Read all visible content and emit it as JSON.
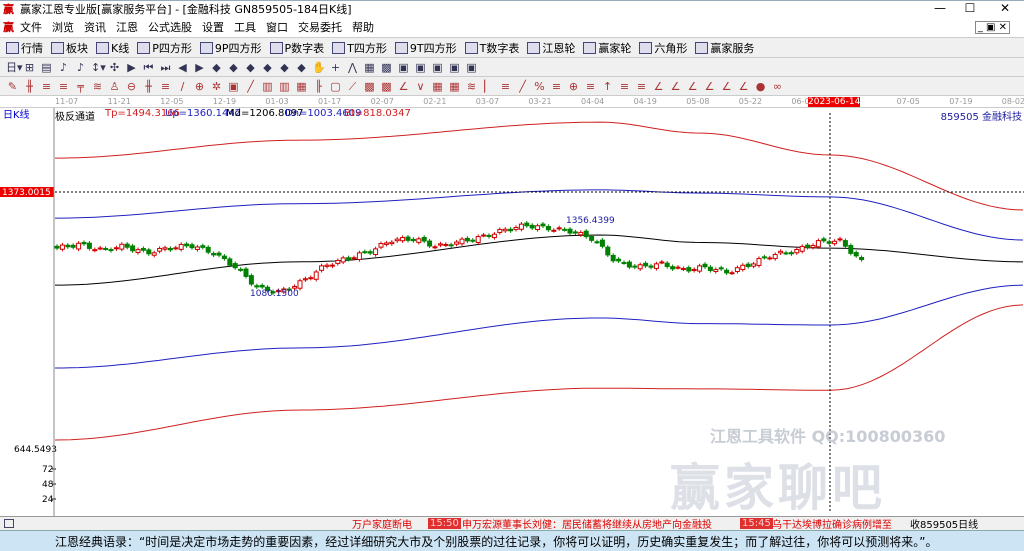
{
  "window": {
    "title": "赢家江恩专业版[赢家服务平台] - [金融科技  GN859505-184日K线]",
    "logo": "赢",
    "min": "—",
    "max": "☐",
    "close": "✕"
  },
  "menu": [
    "文件",
    "浏览",
    "资讯",
    "江恩",
    "公式选股",
    "设置",
    "工具",
    "窗口",
    "交易委托",
    "帮助"
  ],
  "toolbar": [
    {
      "icon": "grid-icon",
      "label": "行情"
    },
    {
      "icon": "blocks-icon",
      "label": "板块"
    },
    {
      "icon": "candle-icon",
      "label": "K线"
    },
    {
      "icon": "p-square-icon",
      "label": "P四方形"
    },
    {
      "icon": "9p-icon",
      "label": "9P四方形"
    },
    {
      "icon": "pn-icon",
      "label": "P数字表"
    },
    {
      "icon": "t-square-icon",
      "label": "T四方形"
    },
    {
      "icon": "9t-icon",
      "label": "9T四方形"
    },
    {
      "icon": "tn-icon",
      "label": "T数字表"
    },
    {
      "icon": "wheel-icon",
      "label": "江恩轮"
    },
    {
      "icon": "winner-wheel-icon",
      "label": "赢家轮"
    },
    {
      "icon": "hexagon-icon",
      "label": "六角形"
    },
    {
      "icon": "dollar-icon",
      "label": "赢家服务"
    }
  ],
  "period_label": "日K线",
  "indicator": {
    "name": "极反通道",
    "tp": "Tp=1494.3166",
    "up": "Up=1360.1442",
    "md": "Md=1206.8097",
    "dn": "Dn=1003.4609",
    "bt": "Bt=818.0347"
  },
  "stock_label": "859505  金融科技",
  "dates": [
    "11-07",
    "11-21",
    "12-05",
    "12-19",
    "01-03",
    "01-17",
    "02-07",
    "02-21",
    "03-07",
    "03-21",
    "04-04",
    "04-19",
    "05-08",
    "05-22",
    "06-05",
    "2023-06-14",
    "07-05",
    "07-19",
    "08-02"
  ],
  "price_labels": {
    "cursor": "1373.0015",
    "low": "644.5493",
    "vol": [
      "72",
      "48",
      "24"
    ]
  },
  "annotations": {
    "high": "1356.4399",
    "low": "1080.1500"
  },
  "colors": {
    "tp": "#d02020",
    "up": "#2020c0",
    "md": "#000000",
    "dn": "#2020c0",
    "bt": "#d02020",
    "up_candle": "#d00000",
    "down_candle": "#008000"
  },
  "chart_data": {
    "type": "candlestick",
    "price_range": [
      644.5493,
      1373.0015
    ],
    "close_anchors": [
      1214,
      1225,
      1208,
      1220,
      1200,
      1214,
      1222,
      1200,
      1160,
      1100,
      1089,
      1120,
      1165,
      1185,
      1205,
      1237,
      1240,
      1218,
      1232,
      1245,
      1265,
      1279,
      1270,
      1262,
      1240,
      1175,
      1160,
      1170,
      1152,
      1160,
      1145,
      1168,
      1195,
      1205,
      1230,
      1236,
      1176
    ],
    "tp": [
      1469,
      1520,
      1571,
      1540,
      1478,
      1322
    ],
    "up": [
      1299,
      1340,
      1379,
      1370,
      1359,
      1237
    ],
    "md": [
      1109,
      1175,
      1251,
      1230,
      1214,
      1175
    ],
    "dn": [
      874,
      931,
      1016,
      1000,
      996,
      1109
    ],
    "bt": [
      670,
      755,
      817,
      815,
      811,
      1053
    ]
  },
  "watermark": {
    "text1": "江恩工具软件  QQ:100800360",
    "text2": "赢家聊吧"
  },
  "status": {
    "news1": "万户家庭断电",
    "time1": "15:50",
    "news2": "申万宏源董事长刘健：居民储蓄将继续从房地产向金融投",
    "time2": "15:45",
    "news3": "乌干达埃博拉确诊病例增至",
    "code": "收859505日线"
  },
  "quote": "江恩经典语录：“时间是决定市场走势的重要因素，经过详细研究大市及个别股票的过往记录，你将可以证明，历史确实重复发生；而了解过往，你将可以预测将来。”。"
}
